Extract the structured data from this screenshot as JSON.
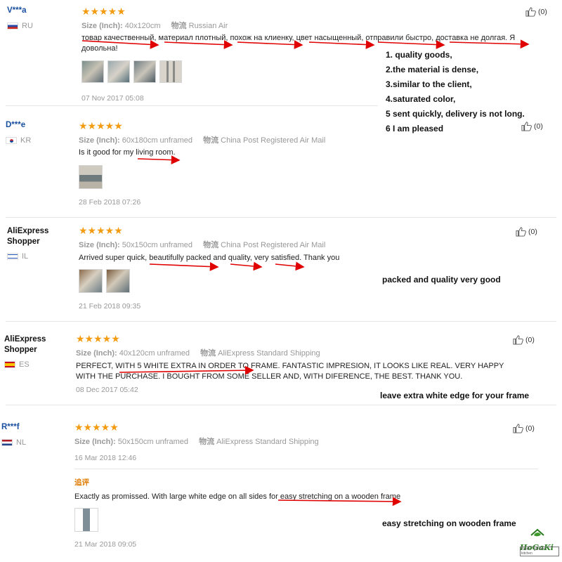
{
  "reviews": [
    {
      "user": "V***a",
      "country": "RU",
      "stars": "★★★★★",
      "size_label": "Size (Inch):",
      "size_value": "40x120cm",
      "ship_label": "物流",
      "ship_value": "Russian Air",
      "text": "товар качественный, материал плотный, похож на клиенку, цвет насыщенный, отправили быстро, доставка не долгая. Я довольна!",
      "date": "07 Nov 2017 05:08",
      "helpful": "(0)"
    },
    {
      "user": "D***e",
      "country": "KR",
      "stars": "★★★★★",
      "size_label": "Size (Inch):",
      "size_value": "60x180cm unframed",
      "ship_label": "物流",
      "ship_value": "China Post Registered Air Mail",
      "text": "Is it good for my living room.",
      "date": "28 Feb 2018 07:26",
      "helpful": "(0)"
    },
    {
      "user": "AliExpress Shopper",
      "country": "IL",
      "stars": "★★★★★",
      "size_label": "Size (Inch):",
      "size_value": "50x150cm unframed",
      "ship_label": "物流",
      "ship_value": "China Post Registered Air Mail",
      "text": "Arrived super quick, beautifully packed and quality, very satisfied. Thank you",
      "date": "21 Feb 2018 09:35",
      "helpful": "(0)"
    },
    {
      "user": "AliExpress Shopper",
      "country": "ES",
      "stars": "★★★★★",
      "size_label": "Size (Inch):",
      "size_value": "40x120cm unframed",
      "ship_label": "物流",
      "ship_value": "AliExpress Standard Shipping",
      "text": "PERFECT, WITH 5 WHITE EXTRA IN ORDER TO FRAME. FANTASTIC IMPRESION, IT LOOKS LIKE REAL. VERY HAPPY WITH THE PURCHASE. I BOUGHT FROM SOME SELLER AND, WITH DIFERENCE, THE BEST. THANK YOU.",
      "date": "08 Dec 2017 05:42",
      "helpful": "(0)"
    },
    {
      "user": "R***f",
      "country": "NL",
      "stars": "★★★★★",
      "size_label": "Size (Inch):",
      "size_value": "50x150cm unframed",
      "ship_label": "物流",
      "ship_value": "AliExpress Standard Shipping",
      "date": "16 Mar 2018 12:46",
      "followup_label": "追评",
      "followup_text": "Exactly as promissed. With large white edge on all sides for easy stretching on a wooden frame",
      "followup_date": "21 Mar 2018 09:05",
      "helpful": "(0)"
    }
  ],
  "annotations": {
    "list": [
      "1. quality goods,",
      "2.the material is dense,",
      "3.similar to the client,",
      "4.saturated color,",
      "5 sent quickly, delivery is not long.",
      "6 I am pleased"
    ],
    "packed": "packed and  quality very good",
    "edge": "leave extra white edge for your frame",
    "stretching": "easy stretching  on  wooden frame"
  },
  "logo": {
    "name": "HoGaKi",
    "tagline": "Home · garden · kitchen"
  },
  "colors": {
    "star": "#f39c12",
    "arrow": "#e00000",
    "username_blue": "#1a4fa0",
    "muted": "#999999",
    "followup": "#e07b00"
  }
}
